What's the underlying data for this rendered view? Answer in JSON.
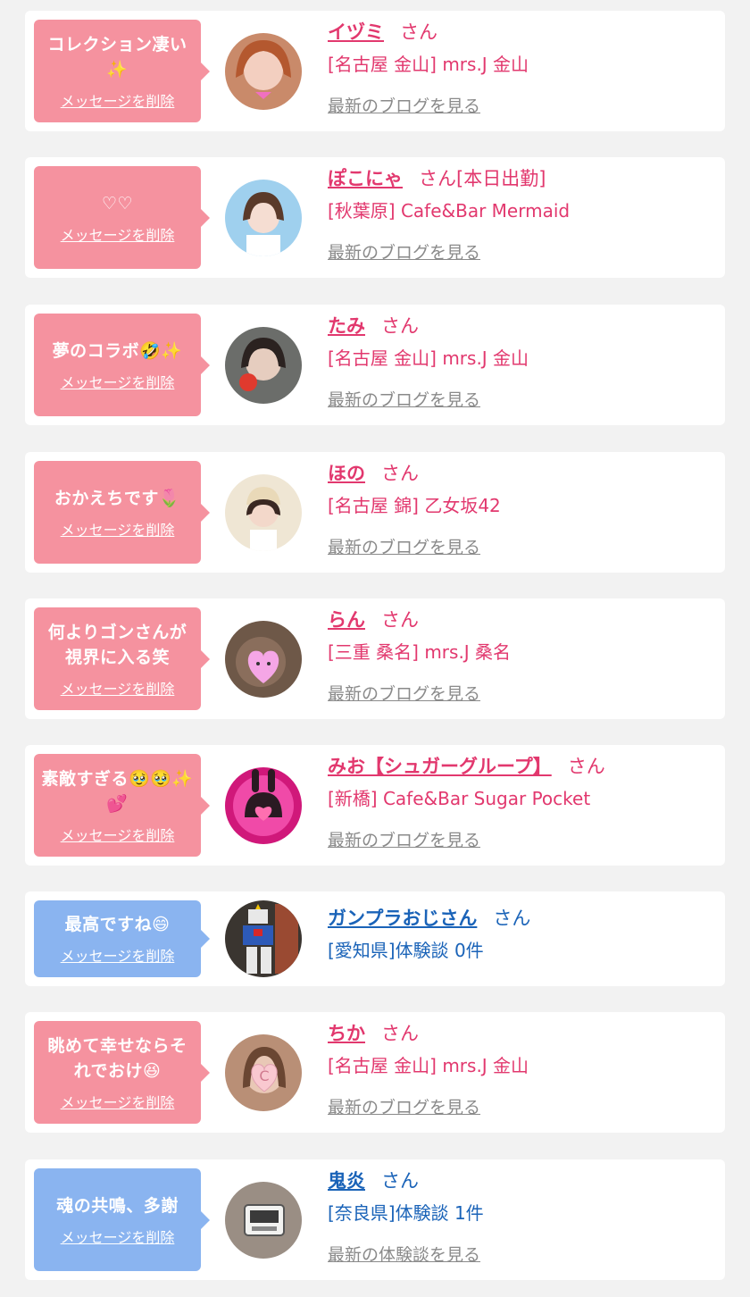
{
  "messages": [
    {
      "message": "コレクション凄い✨",
      "delete_label": "メッセージを削除",
      "name": "イヅミ",
      "honorific": "さん",
      "shop": "[名古屋 金山] mrs.J 金山",
      "link": "最新のブログを見る"
    },
    {
      "message": "♡♡",
      "delete_label": "メッセージを削除",
      "name": "ぽこにゃ",
      "honorific": "さん[本日出勤]",
      "shop": "[秋葉原] Cafe&Bar Mermaid",
      "link": "最新のブログを見る"
    },
    {
      "message": "夢のコラボ🤣✨",
      "delete_label": "メッセージを削除",
      "name": "たみ",
      "honorific": "さん",
      "shop": "[名古屋 金山] mrs.J 金山",
      "link": "最新のブログを見る"
    },
    {
      "message": "おかえちです🌷",
      "delete_label": "メッセージを削除",
      "name": "ほの",
      "honorific": "さん",
      "shop": "[名古屋 錦] 乙女坂42",
      "link": "最新のブログを見る"
    },
    {
      "message": "何よりゴンさんが視界に入る笑",
      "delete_label": "メッセージを削除",
      "name": "らん",
      "honorific": "さん",
      "shop": "[三重 桑名] mrs.J 桑名",
      "link": "最新のブログを見る"
    },
    {
      "message": "素敵すぎる🥹🥹✨💕",
      "delete_label": "メッセージを削除",
      "name": "みお【シュガーグループ】",
      "honorific": "さん",
      "shop": "[新橋] Cafe&Bar Sugar Pocket",
      "link": "最新のブログを見る"
    },
    {
      "message": "最高ですね😄",
      "delete_label": "メッセージを削除",
      "name": "ガンプラおじさん",
      "honorific": "さん",
      "shop": "[愛知県]体験談 0件",
      "link": ""
    },
    {
      "message": "眺めて幸せならそれでおけ😆",
      "delete_label": "メッセージを削除",
      "name": "ちか",
      "honorific": "さん",
      "shop": "[名古屋 金山] mrs.J 金山",
      "link": "最新のブログを見る"
    },
    {
      "message": "魂の共鳴、多謝",
      "delete_label": "メッセージを削除",
      "name": "鬼炎",
      "honorific": "さん",
      "shop": "[奈良県]体験談 1件",
      "link": "最新の体験談を見る"
    }
  ],
  "colors": {
    "pink_bubble": "#f5929f",
    "blue_bubble": "#8ab4f0",
    "pink_text": "#e2386e",
    "blue_text": "#1a63b8",
    "link_gray": "#8a8a8a"
  }
}
